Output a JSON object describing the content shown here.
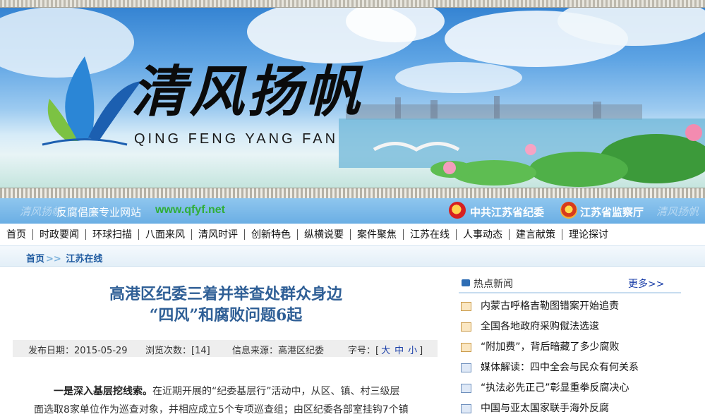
{
  "banner": {
    "logo_cn": "清风扬帆",
    "logo_en": "QING FENG YANG FAN"
  },
  "slogan_bar": {
    "slogan": "反腐倡廉专业网站",
    "url": "www.qfyf.net",
    "org1": "中共江苏省纪委",
    "org2": "江苏省监察厅",
    "deco_left": "清风扬帆",
    "deco_right": "清风扬帆"
  },
  "nav": {
    "items": [
      "首页",
      "时政要闻",
      "环球扫描",
      "八面来风",
      "清风时评",
      "创新特色",
      "纵横说要",
      "案件聚焦",
      "江苏在线",
      "人事动态",
      "建言献策",
      "理论探讨"
    ]
  },
  "breadcrumb": {
    "home": "首页",
    "separator": ">>",
    "current": "江苏在线"
  },
  "article": {
    "title_line1": "高港区纪委三着并举查处群众身边",
    "title_line2": "“四风”和腐败问题6起",
    "publish_date": "发布日期：2015-05-29",
    "views": "浏览次数：[14]",
    "source": "信息来源：高港区纪委",
    "font_label": "字号：[",
    "font_large": "大",
    "font_medium": "中",
    "font_small": "小",
    "font_close": "]",
    "lead_bold": "一是深入基层挖线索。",
    "lead_text": "在近期开展的“纪委基层行”活动中，从区、镇、村三级层",
    "line2": "面选取8家单位作为巡查对象，并相应成立5个专项巡查组；由区纪委各部室挂钩7个镇"
  },
  "sidebar": {
    "title": "热点新闻",
    "more": "更多>>",
    "news": [
      {
        "text": "内蒙古呼格吉勒图错案开始追责",
        "icon": "doc-icon-orange"
      },
      {
        "text": "全国各地政府采购僦法选逡",
        "icon": "doc-icon-orange"
      },
      {
        "text": "“附加费”，背后暗藏了多少腐败",
        "icon": "doc-icon-orange"
      },
      {
        "text": "媒体解读：四中全会与民众有何关系",
        "icon": "doc-icon-blue"
      },
      {
        "text": "“执法必先正己”彰显重拳反腐决心",
        "icon": "doc-icon-blue"
      },
      {
        "text": "中国与亚太国家联手海外反腐",
        "icon": "doc-icon-blue"
      }
    ]
  },
  "colors": {
    "title_blue": "#2f5f96",
    "link_blue": "#1a3ea8",
    "url_green": "#2fae38",
    "slogan_bar": "#6aaee4"
  }
}
